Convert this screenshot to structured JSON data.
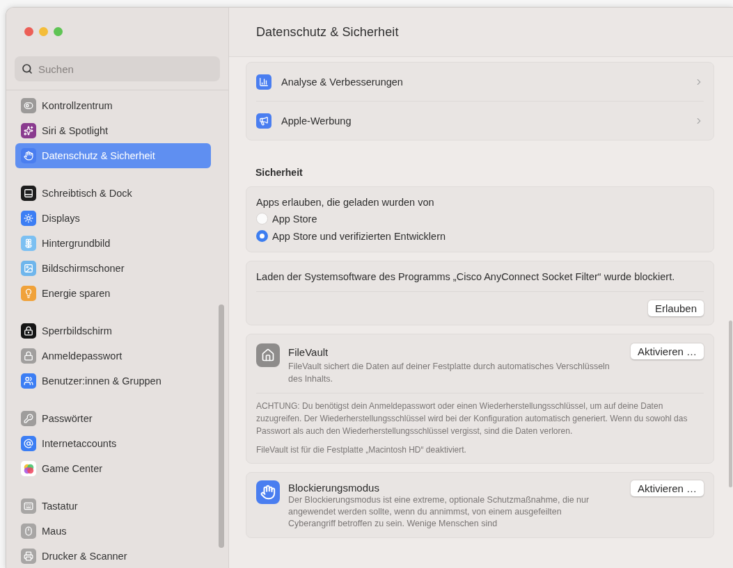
{
  "window": {
    "title": "Datenschutz & Sicherheit"
  },
  "sidebar": {
    "search": {
      "placeholder": "Suchen"
    },
    "groups": [
      [
        {
          "label": "Kontrollzentrum",
          "kind": "controls",
          "selected": false
        },
        {
          "label": "Siri & Spotlight",
          "kind": "siri",
          "selected": false
        },
        {
          "label": "Datenschutz & Sicherheit",
          "kind": "privacy",
          "selected": true
        }
      ],
      [
        {
          "label": "Schreibtisch & Dock",
          "kind": "dock",
          "selected": false
        },
        {
          "label": "Displays",
          "kind": "displays",
          "selected": false
        },
        {
          "label": "Hintergrundbild",
          "kind": "wallpaper",
          "selected": false
        },
        {
          "label": "Bildschirmschoner",
          "kind": "screensaver",
          "selected": false
        },
        {
          "label": "Energie sparen",
          "kind": "energy",
          "selected": false
        }
      ],
      [
        {
          "label": "Sperrbildschirm",
          "kind": "lockscreen",
          "selected": false
        },
        {
          "label": "Anmeldepasswort",
          "kind": "password",
          "selected": false
        },
        {
          "label": "Benutzer:innen & Gruppen",
          "kind": "users",
          "selected": false
        }
      ],
      [
        {
          "label": "Passwörter",
          "kind": "keys",
          "selected": false
        },
        {
          "label": "Internetaccounts",
          "kind": "accounts",
          "selected": false
        },
        {
          "label": "Game Center",
          "kind": "gamecenter",
          "selected": false
        }
      ],
      [
        {
          "label": "Tastatur",
          "kind": "keyboard",
          "selected": false
        },
        {
          "label": "Maus",
          "kind": "mouse",
          "selected": false
        },
        {
          "label": "Drucker & Scanner",
          "kind": "printer",
          "selected": false
        }
      ]
    ]
  },
  "privacy_rows": [
    {
      "label": "Analyse & Verbesserungen",
      "kind": "analytics"
    },
    {
      "label": "Apple-Werbung",
      "kind": "ads"
    }
  ],
  "security": {
    "heading": "Sicherheit",
    "app_source": {
      "label": "Apps erlauben, die geladen wurden von",
      "options": [
        {
          "label": "App Store",
          "selected": false
        },
        {
          "label": "App Store und verifizierten Entwicklern",
          "selected": true
        }
      ]
    },
    "blocked": {
      "message": "Laden der Systemsoftware des Programms „Cisco AnyConnect Socket Filter“ wurde blockiert.",
      "button": "Erlauben"
    },
    "filevault": {
      "title": "FileVault",
      "description": "FileVault sichert die Daten auf deiner Festplatte durch automatisches Verschlüsseln des Inhalts.",
      "button": "Aktivieren …",
      "warning": "ACHTUNG: Du benötigst dein Anmeldepasswort oder einen Wiederherstellungsschlüssel, um auf deine Daten zuzugreifen. Der Wiederherstellungsschlüssel wird bei der Konfiguration automatisch generiert. Wenn du sowohl das Passwort als auch den Wiederherstellungsschlüssel vergisst, sind die Daten verloren.",
      "status": "FileVault ist für die Festplatte „Macintosh HD“ deaktiviert."
    },
    "lockdown": {
      "title": "Blockierungsmodus",
      "description": "Der Blockierungsmodus ist eine extreme, optionale Schutzmaßnahme, die nur angewendet werden sollte, wenn du annimmst, von einem ausgefeilten Cyberangriff betroffen zu sein. Wenige Menschen sind",
      "button": "Aktivieren …"
    }
  }
}
